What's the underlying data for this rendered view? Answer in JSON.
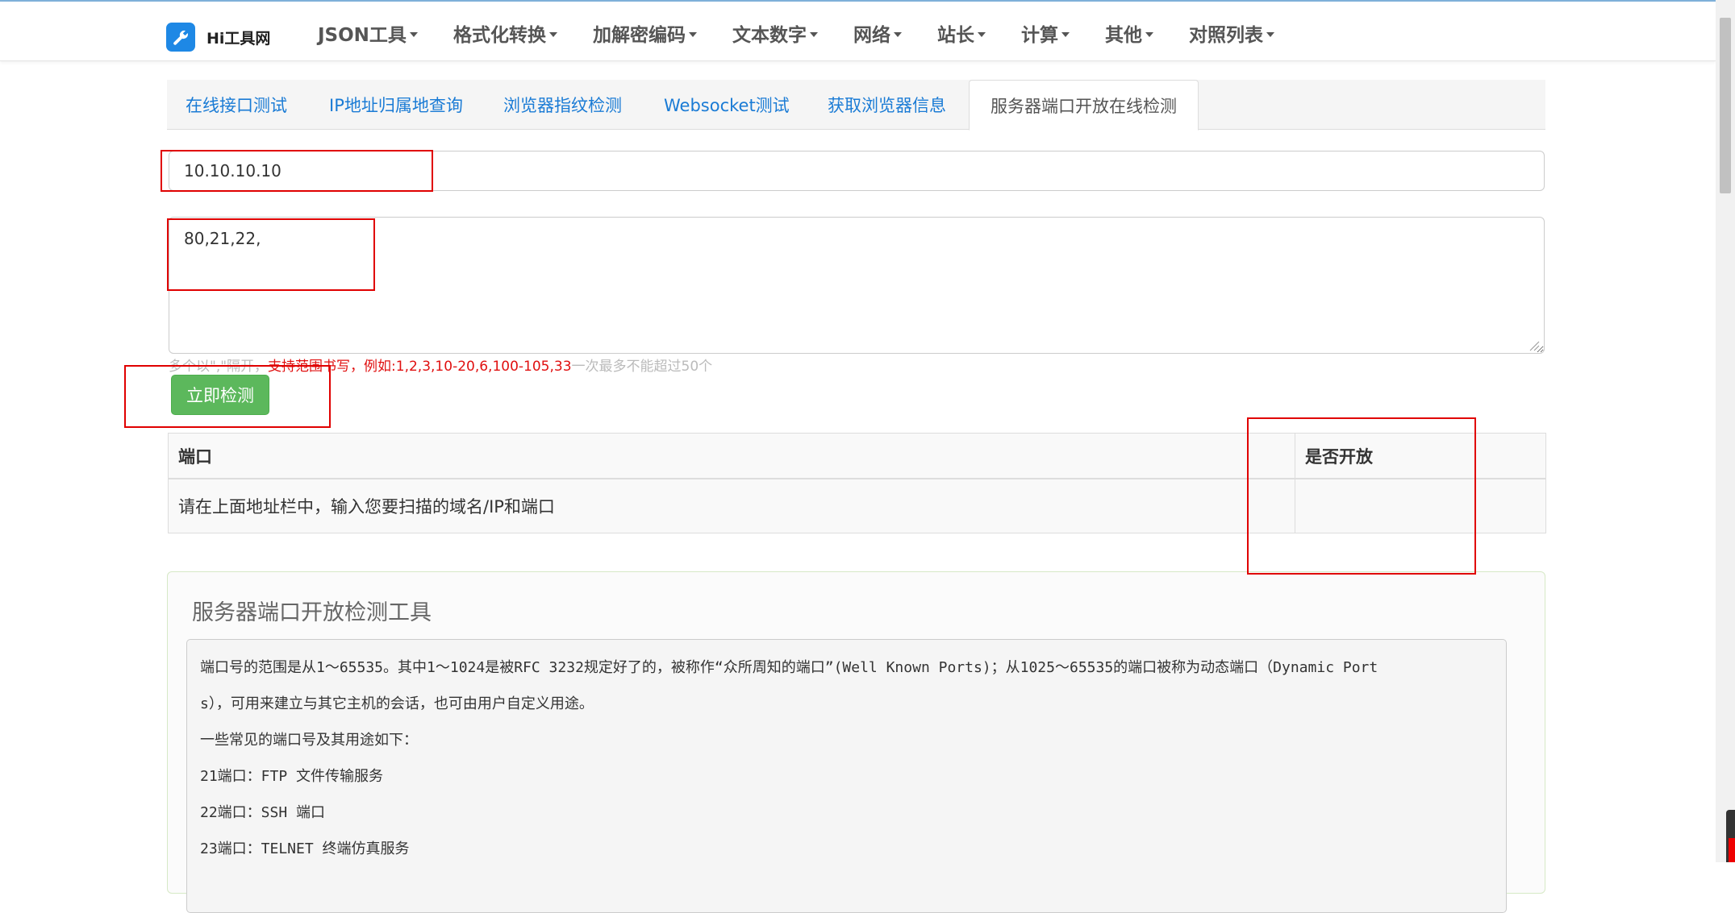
{
  "brand": {
    "name": "Hi工具网",
    "icon": "wrench-icon"
  },
  "nav": {
    "items": [
      {
        "label": "JSON工具"
      },
      {
        "label": "格式化转换"
      },
      {
        "label": "加解密编码"
      },
      {
        "label": "文本数字"
      },
      {
        "label": "网络"
      },
      {
        "label": "站长"
      },
      {
        "label": "计算"
      },
      {
        "label": "其他"
      },
      {
        "label": "对照列表"
      }
    ]
  },
  "tabs": [
    {
      "label": "在线接口测试"
    },
    {
      "label": "IP地址归属地查询"
    },
    {
      "label": "浏览器指纹检测"
    },
    {
      "label": "Websocket测试"
    },
    {
      "label": "获取浏览器信息"
    },
    {
      "label": "服务器端口开放在线检测",
      "active": true
    }
  ],
  "form": {
    "host_value": "10.10.10.10",
    "ports_value": "80,21,22,",
    "hint_prefix": "多个以\",\"隔开，",
    "hint_red": "支持范围书写，例如:1,2,3,10-20,6,100-105,33",
    "hint_suffix": "一次最多不能超过50个",
    "detect_button": "立即检测"
  },
  "result_table": {
    "headers": [
      "端口",
      "是否开放"
    ],
    "rows": [
      [
        "请在上面地址栏中，输入您要扫描的域名/IP和端口",
        ""
      ]
    ]
  },
  "info": {
    "title": "服务器端口开放检测工具",
    "lines": [
      "端口号的范围是从1～65535。其中1～1024是被RFC 3232规定好了的，被称作“众所周知的端口”(Well Known Ports)；从1025～65535的端口被称为动态端口（Dynamic Port",
      "s），可用来建立与其它主机的会话，也可由用户自定义用途。",
      "一些常见的端口号及其用途如下：",
      "21端口：FTP 文件传输服务",
      "22端口：SSH 端口",
      "23端口：TELNET 终端仿真服务"
    ]
  },
  "colors": {
    "link_blue": "#1a7bd5",
    "button_green": "#5cb85c",
    "annotation_red": "#e00000",
    "hint_red": "#e01010"
  }
}
